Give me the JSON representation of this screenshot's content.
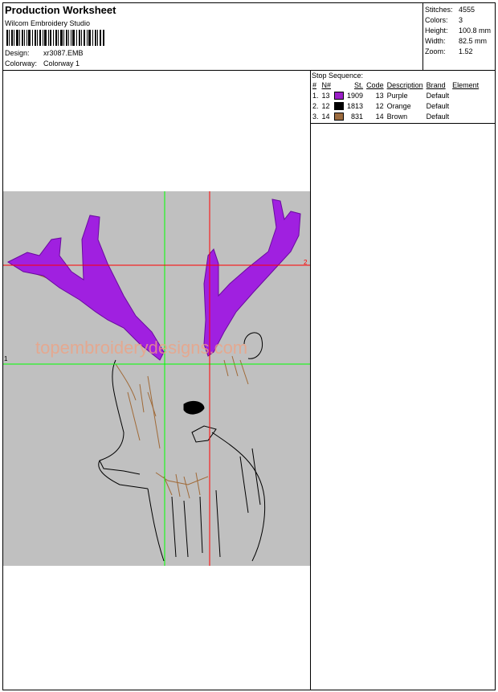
{
  "header": {
    "title": "Production Worksheet",
    "software": "Wilcom Embroidery Studio",
    "design_label": "Design:",
    "design_value": "xr3087.EMB",
    "colorway_label": "Colorway:",
    "colorway_value": "Colorway 1"
  },
  "stats": [
    {
      "label": "Stitches:",
      "value": "4555"
    },
    {
      "label": "Colors:",
      "value": "3"
    },
    {
      "label": "Height:",
      "value": "100.8 mm"
    },
    {
      "label": "Width:",
      "value": "82.5 mm"
    },
    {
      "label": "Zoom:",
      "value": "1.52"
    }
  ],
  "stop_sequence": {
    "title": "Stop Sequence:",
    "columns": [
      "#",
      "N#",
      "St.",
      "Code",
      "Description",
      "Brand",
      "Element"
    ],
    "rows": [
      {
        "num": "1.",
        "n": "13",
        "color": "#9b1fc7",
        "st": "1909",
        "code": "13",
        "description": "Purple",
        "brand": "Default"
      },
      {
        "num": "2.",
        "n": "12",
        "color": "#000000",
        "st": "1813",
        "code": "12",
        "description": "Orange",
        "brand": "Default"
      },
      {
        "num": "3.",
        "n": "14",
        "color": "#9c6b3e",
        "st": "831",
        "code": "14",
        "description": "Brown",
        "brand": "Default"
      }
    ]
  },
  "preview": {
    "watermark": "topembroiderydesigns.com",
    "axis_1": "1",
    "axis_2": "2",
    "thread_colors": {
      "purple": "#a020e0",
      "black": "#000000",
      "brown": "#a06a38"
    }
  }
}
